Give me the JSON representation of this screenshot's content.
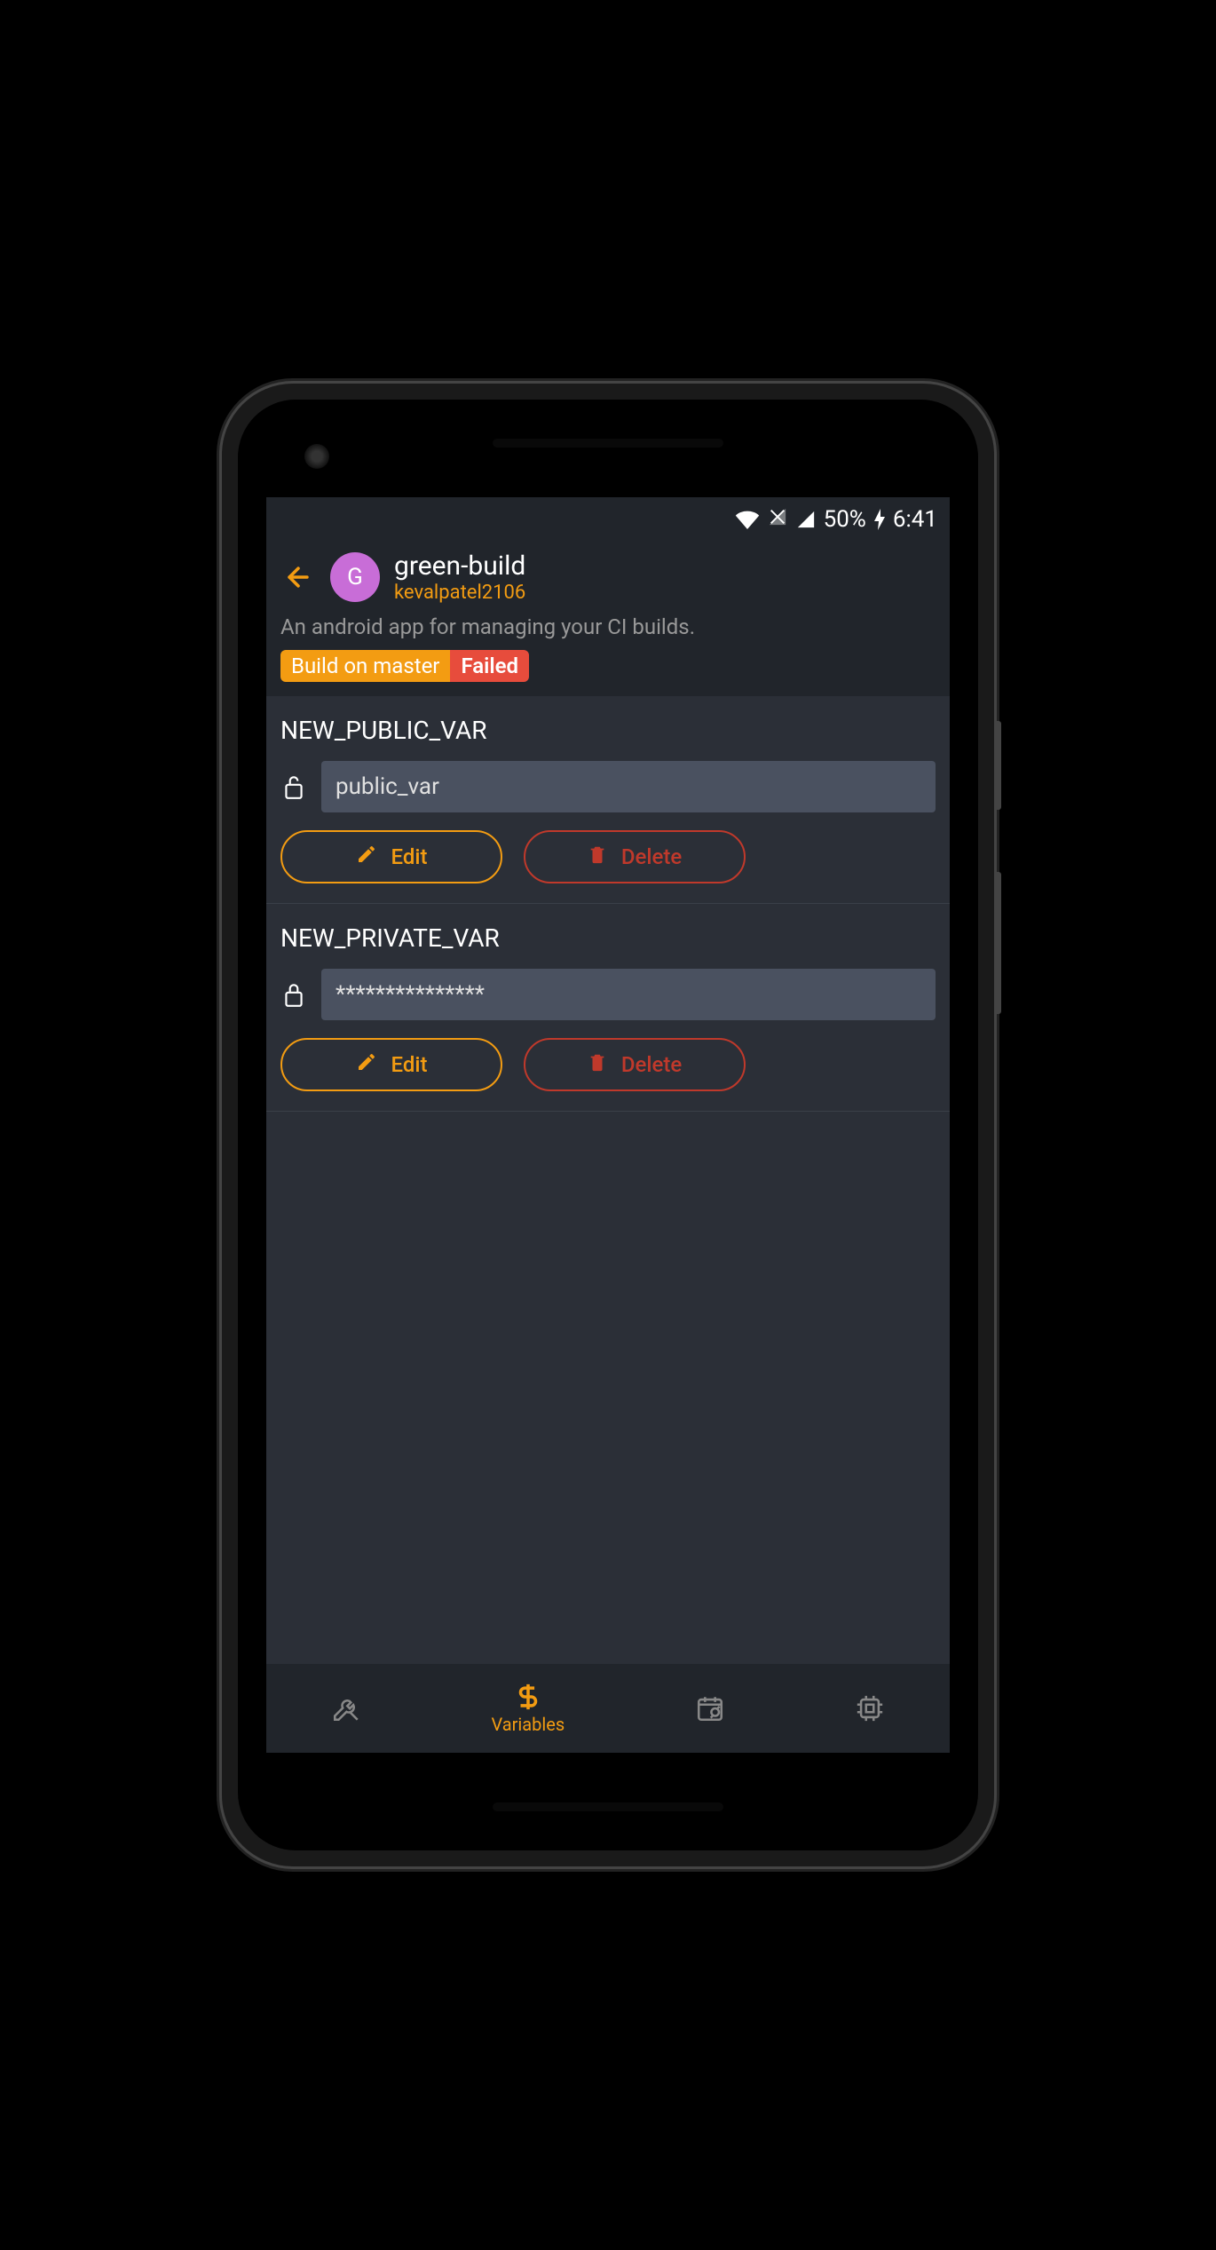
{
  "statusbar": {
    "battery": "50%",
    "time": "6:41"
  },
  "header": {
    "avatar_letter": "G",
    "title": "green-build",
    "owner": "kevalpatel2106",
    "description": "An android app for managing your CI builds.",
    "badge_branch": "Build on master",
    "badge_status": "Failed"
  },
  "variables": [
    {
      "name": "NEW_PUBLIC_VAR",
      "value": "public_var",
      "locked": false,
      "edit_label": "Edit",
      "delete_label": "Delete"
    },
    {
      "name": "NEW_PRIVATE_VAR",
      "value": "***************",
      "locked": true,
      "edit_label": "Edit",
      "delete_label": "Delete"
    }
  ],
  "bottomnav": {
    "variables_label": "Variables"
  }
}
